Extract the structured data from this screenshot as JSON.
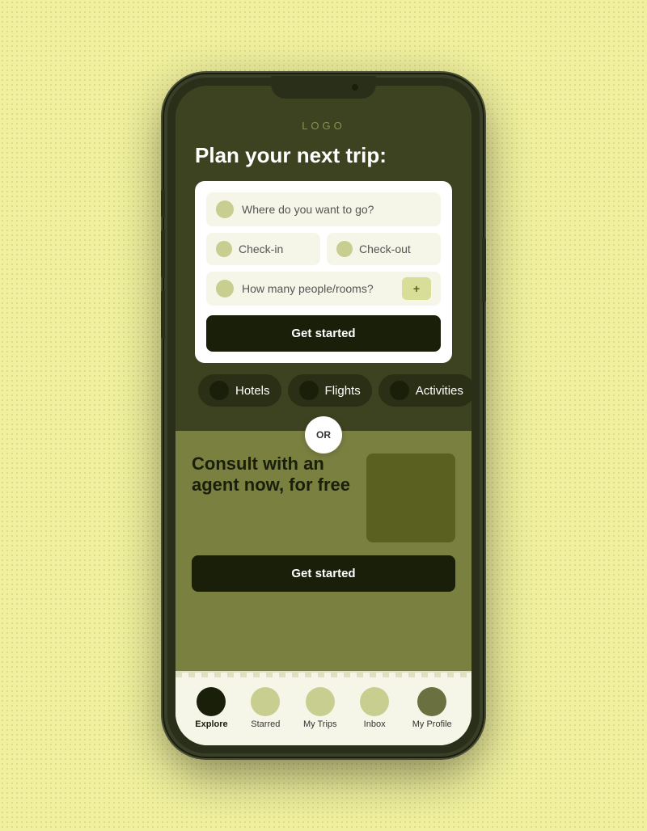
{
  "app": {
    "logo": "LOGO",
    "background_color": "#f0f0a0"
  },
  "header": {
    "title": "Plan your next trip:"
  },
  "search_form": {
    "destination_placeholder": "Where do you want to go?",
    "checkin_label": "Check-in",
    "checkout_label": "Check-out",
    "people_placeholder": "How many people/rooms?",
    "get_started_label": "Get started"
  },
  "category_tabs": [
    {
      "id": "hotels",
      "label": "Hotels"
    },
    {
      "id": "flights",
      "label": "Flights"
    },
    {
      "id": "activities",
      "label": "Activities"
    }
  ],
  "or_divider": "OR",
  "consult_section": {
    "title": "Consult with an agent now, for free",
    "get_started_label": "Get started"
  },
  "bottom_nav": {
    "items": [
      {
        "id": "explore",
        "label": "Explore",
        "active": true
      },
      {
        "id": "starred",
        "label": "Starred",
        "active": false
      },
      {
        "id": "my-trips",
        "label": "My Trips",
        "active": false
      },
      {
        "id": "inbox",
        "label": "Inbox",
        "active": false
      },
      {
        "id": "my-profile",
        "label": "My Profile",
        "active": false
      }
    ]
  }
}
